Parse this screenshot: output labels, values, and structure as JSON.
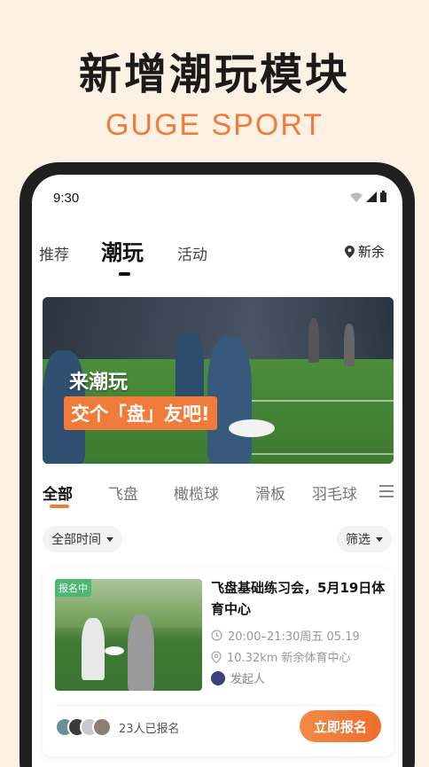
{
  "promo": {
    "headline": "新增潮玩模块",
    "subline": "GUGE SPORT"
  },
  "status_bar": {
    "time": "9:30"
  },
  "top_tabs": [
    {
      "label": "推荐"
    },
    {
      "label": "潮玩",
      "active": true
    },
    {
      "label": "活动"
    }
  ],
  "location": {
    "label": "新余"
  },
  "banner": {
    "line1": "来潮玩",
    "line2": "交个「盘」友吧!"
  },
  "category_tabs": [
    {
      "label": "全部",
      "active": true
    },
    {
      "label": "飞盘"
    },
    {
      "label": "橄榄球"
    },
    {
      "label": "滑板"
    },
    {
      "label": "羽毛球"
    }
  ],
  "filters": {
    "time": "全部时间",
    "filter": "筛选"
  },
  "event_card": {
    "badge": "报名中",
    "title": "飞盘基础练习会，5月19日体育中心",
    "time": "20:00–21:30周五 05.19",
    "distance_place": "10.32km 新余体育中心",
    "organizer": "发起人",
    "signed_up": "23人已报名",
    "cta": "立即报名"
  },
  "colors": {
    "accent": "#F07B3A",
    "badge_green": "#4CB873",
    "background": "#FDF1E4"
  }
}
